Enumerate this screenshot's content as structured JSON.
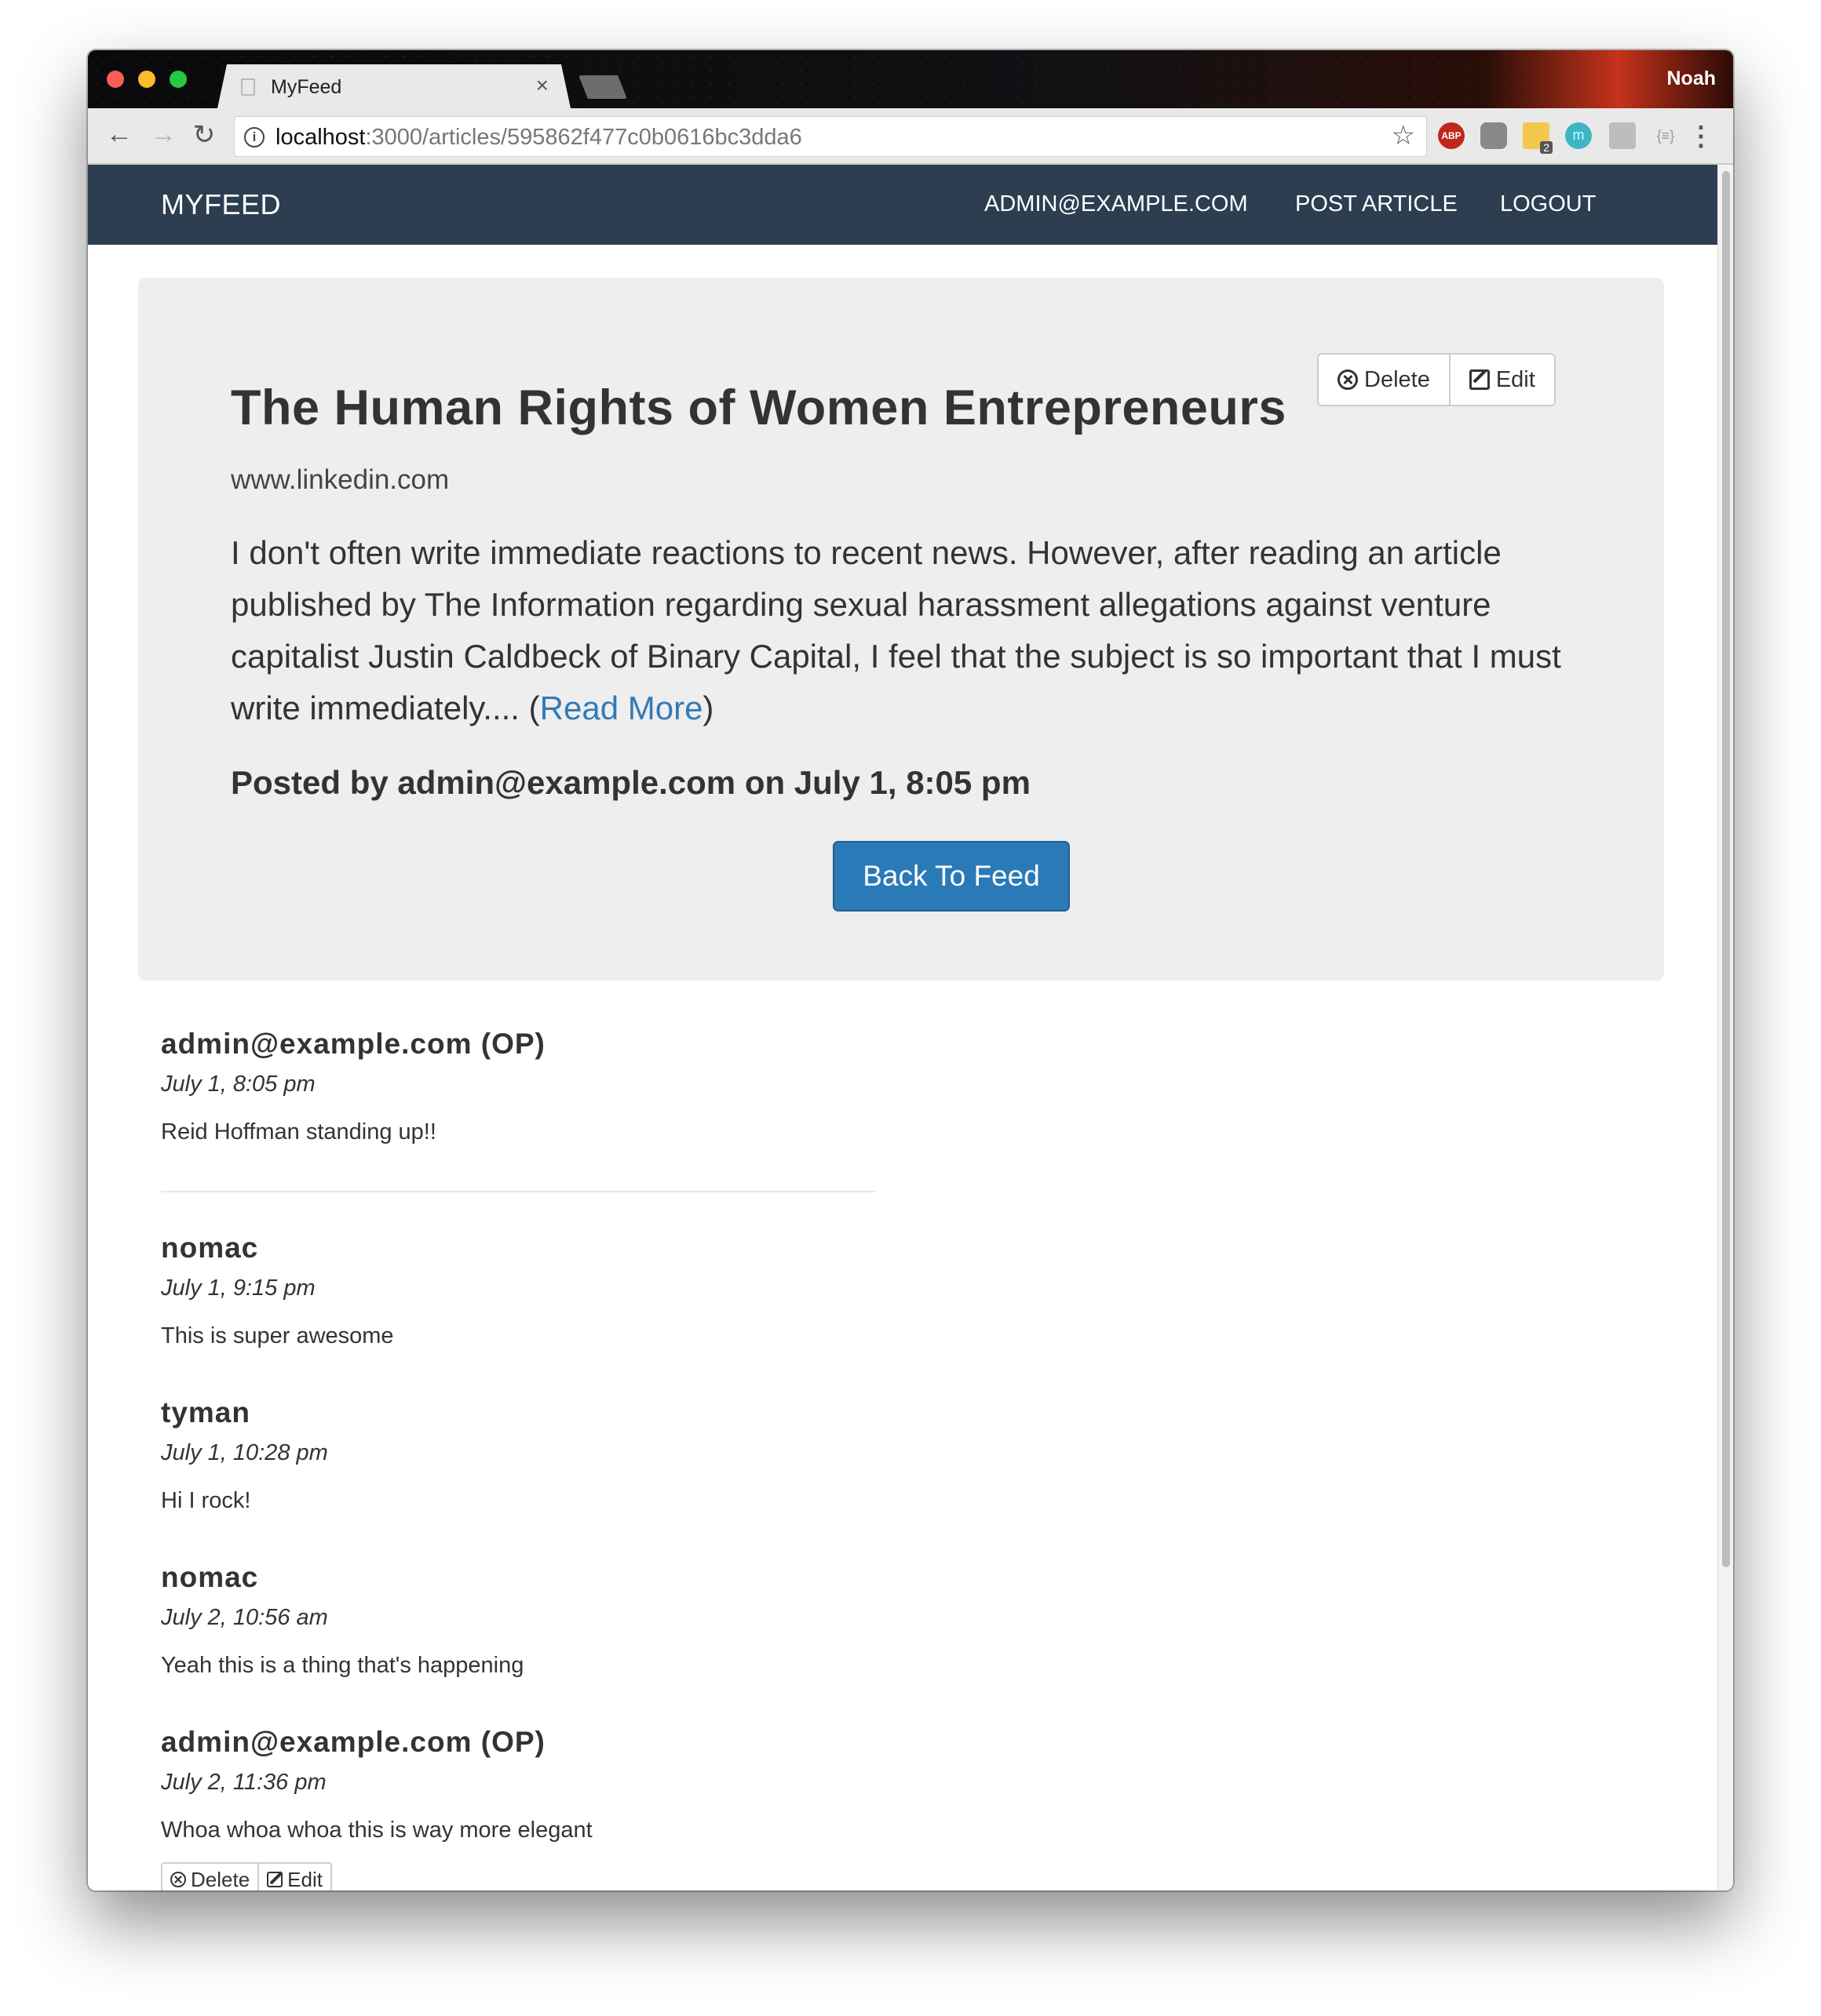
{
  "browser": {
    "tab_title": "MyFeed",
    "tab_close": "×",
    "profile_name": "Noah",
    "url_host": "localhost",
    "url_rest": ":3000/articles/595862f477c0b0616bc3dda6",
    "info_glyph": "i",
    "star_glyph": "☆",
    "ext_abp": "ABP",
    "ext_note_badge": "2",
    "ext_m": "m",
    "ext_json": "{≡}",
    "back_glyph": "←",
    "forward_glyph": "→",
    "reload_glyph": "↻",
    "menu_glyph": "⋮"
  },
  "navbar": {
    "brand": "MYFEED",
    "links": [
      "ADMIN@EXAMPLE.COM",
      "POST ARTICLE",
      "LOGOUT"
    ]
  },
  "article": {
    "delete_label": "Delete",
    "edit_label": "Edit",
    "title": "The Human Rights of Women Entrepreneurs",
    "source": "www.linkedin.com",
    "summary": "I don't often write immediate reactions to recent news. However, after reading an article published by The Information regarding sexual harassment allegations against venture capitalist Justin Caldbeck of Binary Capital, I feel that the subject is so important that I must write immediately....",
    "read_more_open": "(",
    "read_more": "Read More",
    "read_more_close": ")",
    "posted": "Posted by admin@example.com on July 1, 8:05 pm",
    "back_button": "Back To Feed"
  },
  "comments": [
    {
      "author": "admin@example.com (OP)",
      "date": "July 1, 8:05 pm",
      "body": "Reid Hoffman standing up!!"
    },
    {
      "author": "nomac",
      "date": "July 1, 9:15 pm",
      "body": "This is super awesome"
    },
    {
      "author": "tyman",
      "date": "July 1, 10:28 pm",
      "body": "Hi I rock!"
    },
    {
      "author": "nomac",
      "date": "July 2, 10:56 am",
      "body": "Yeah this is a thing that's happening"
    },
    {
      "author": "admin@example.com (OP)",
      "date": "July 2, 11:36 pm",
      "body": "Whoa whoa whoa this is way more elegant",
      "delete_label": "Delete",
      "edit_label": "Edit"
    }
  ],
  "colors": {
    "navbar_bg": "#2c3e50",
    "primary": "#2a7ab8",
    "link": "#337ab7",
    "jumbotron_bg": "#eeeeee"
  }
}
